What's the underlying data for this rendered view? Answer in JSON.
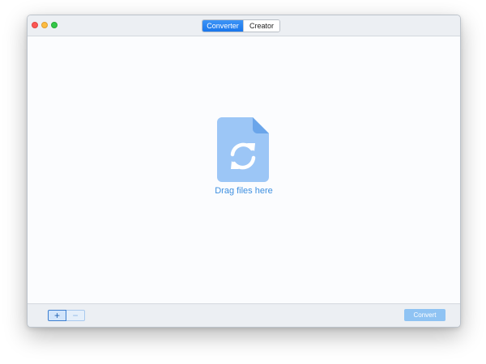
{
  "window": {
    "traffic_lights": [
      "close",
      "minimize",
      "zoom"
    ]
  },
  "mode_switch": {
    "options": [
      "Converter",
      "Creator"
    ],
    "selected": "Converter"
  },
  "dropzone": {
    "icon": "file-convert-icon",
    "label": "Drag files here"
  },
  "footer": {
    "add_label": "+",
    "remove_label": "−",
    "convert_label": "Convert",
    "convert_enabled": false
  },
  "colors": {
    "accent": "#1976ec",
    "drop_icon": "#9cc6f6",
    "drop_label": "#3d8fe0",
    "convert_disabled": "#8fc3f3"
  }
}
